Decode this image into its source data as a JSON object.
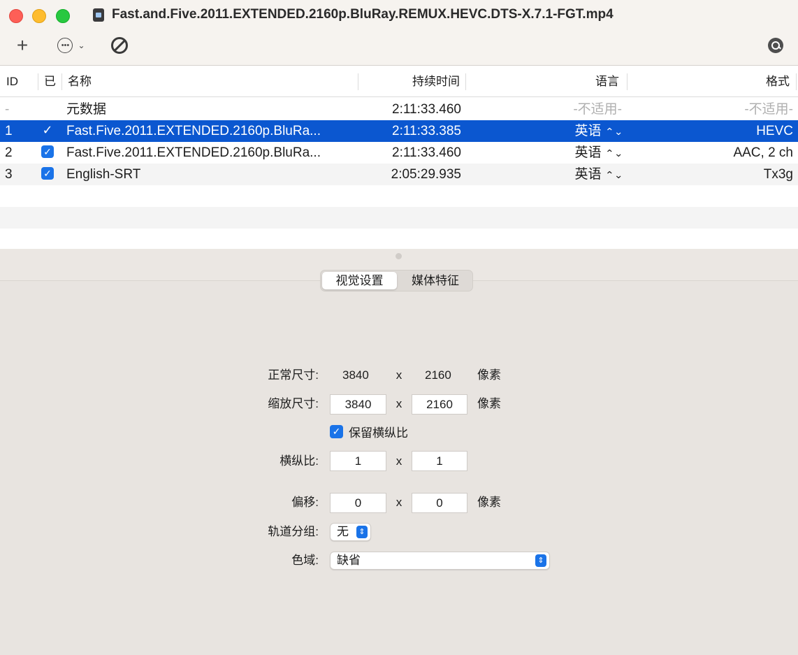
{
  "window": {
    "title": "Fast.and.Five.2011.EXTENDED.2160p.BluRay.REMUX.HEVC.DTS-X.7.1-FGT.mp4"
  },
  "toolbar": {
    "add_icon": "plus-icon",
    "more_icon": "ellipsis-circle-icon",
    "disable_icon": "prohibited-icon",
    "search_icon": "search-icon"
  },
  "table": {
    "headers": {
      "id": "ID",
      "enabled": "已",
      "name": "名称",
      "duration": "持续时间",
      "language": "语言",
      "format": "格式"
    },
    "rows": [
      {
        "id": "-",
        "enabled": false,
        "name": "元数据",
        "duration": "2:11:33.460",
        "language": "-不适用-",
        "format": "-不适用-"
      },
      {
        "id": "1",
        "enabled": true,
        "name": "Fast.Five.2011.EXTENDED.2160p.BluRa...",
        "duration": "2:11:33.385",
        "language": "英语",
        "format": "HEVC",
        "selected": true
      },
      {
        "id": "2",
        "enabled": true,
        "name": "Fast.Five.2011.EXTENDED.2160p.BluRa...",
        "duration": "2:11:33.460",
        "language": "英语",
        "format": "AAC, 2 ch"
      },
      {
        "id": "3",
        "enabled": true,
        "name": "English-SRT",
        "duration": "2:05:29.935",
        "language": "英语",
        "format": "Tx3g"
      }
    ]
  },
  "tabs": {
    "visual": "视觉设置",
    "media": "媒体特征",
    "active": "visual"
  },
  "settings": {
    "normal_size_label": "正常尺寸:",
    "normal_width": "3840",
    "normal_height": "2160",
    "x": "x",
    "unit_pixels": "像素",
    "scaled_size_label": "缩放尺寸:",
    "scaled_width": "3840",
    "scaled_height": "2160",
    "keep_aspect_label": "保留横纵比",
    "keep_aspect": true,
    "aspect_label": "横纵比:",
    "aspect_w": "1",
    "aspect_h": "1",
    "offset_label": "偏移:",
    "offset_x": "0",
    "offset_y": "0",
    "track_group_label": "轨道分组:",
    "track_group_value": "无",
    "color_gamut_label": "色域:",
    "color_gamut_value": "缺省"
  },
  "colors": {
    "selection": "#0b57d0",
    "accent": "#1a73e8"
  }
}
